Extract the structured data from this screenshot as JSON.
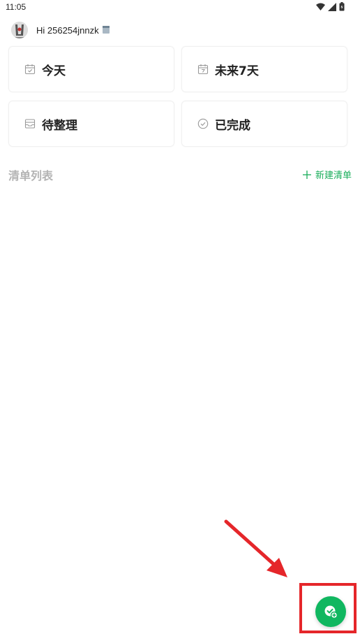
{
  "status_bar": {
    "time": "11:05",
    "icons": [
      "wifi-icon",
      "signal-icon",
      "battery-icon"
    ]
  },
  "header": {
    "greeting": "Hi 256254jnnzk",
    "avatar": "avatar-image",
    "emoji": "notebook-emoji"
  },
  "cards": {
    "today": {
      "label": "今天",
      "icon": "calendar-today-icon"
    },
    "next7": {
      "label": "未来7天",
      "icon": "calendar-7-icon"
    },
    "inbox": {
      "label": "待整理",
      "icon": "inbox-icon"
    },
    "done": {
      "label": "已完成",
      "icon": "check-circle-icon"
    }
  },
  "lists": {
    "title": "清单列表",
    "new_label": "新建清单"
  },
  "fab": {
    "icon": "add-task-icon"
  },
  "colors": {
    "accent": "#10b760",
    "accent_text": "#1aae5b",
    "annotation": "#e5262a",
    "muted": "#b4b4b4"
  }
}
